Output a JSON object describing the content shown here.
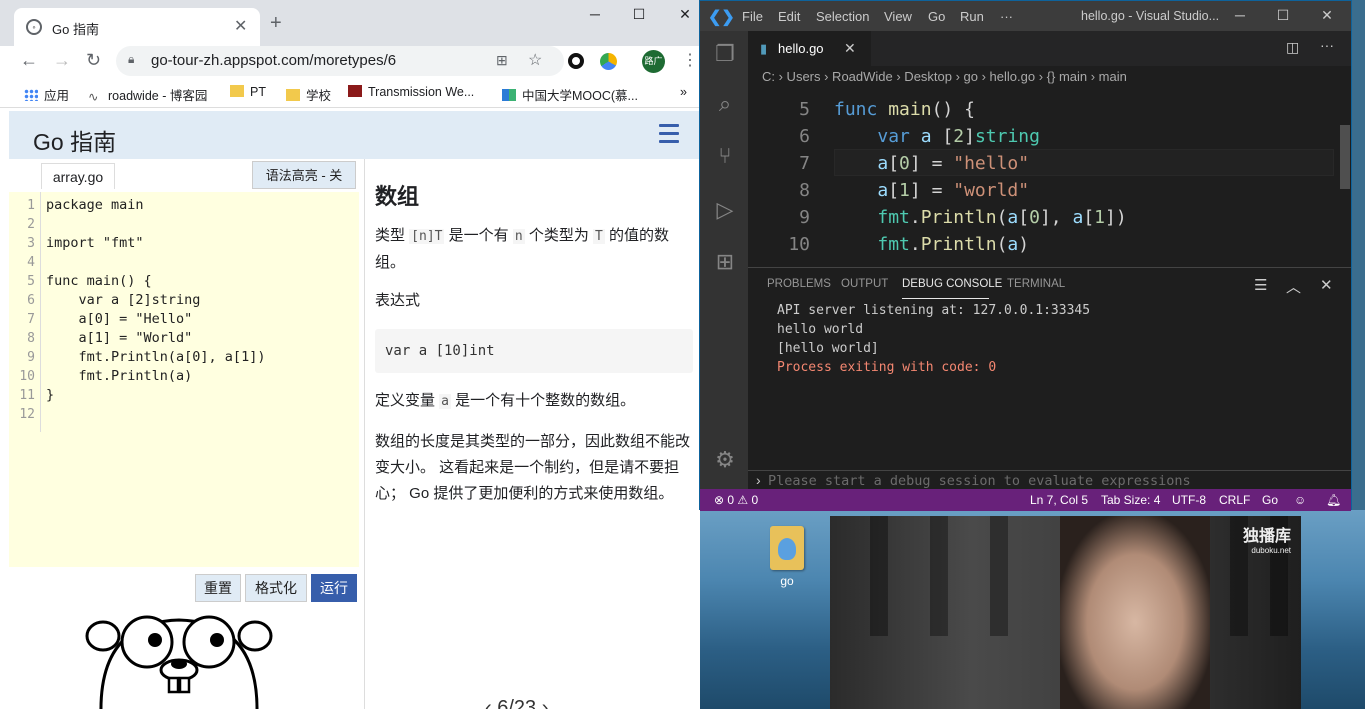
{
  "browser": {
    "tab_title": "Go 指南",
    "url": "go-tour-zh.appspot.com/moretypes/6",
    "profile_label": "路广",
    "bookmarks": [
      "应用",
      "roadwide - 博客园",
      "PT",
      "学校",
      "Transmission We...",
      "中国大学MOOC(慕..."
    ]
  },
  "tour": {
    "title": "Go 指南",
    "file_tab": "array.go",
    "syntax_toggle": "语法高亮 - 关",
    "line_numbers": [
      "1",
      "2",
      "3",
      "4",
      "5",
      "6",
      "7",
      "8",
      "9",
      "10",
      "11",
      "12"
    ],
    "code_lines": [
      "package main",
      "",
      "import \"fmt\"",
      "",
      "func main() {",
      "    var a [2]string",
      "    a[0] = \"Hello\"",
      "    a[1] = \"World\"",
      "    fmt.Println(a[0], a[1])",
      "    fmt.Println(a)",
      "}",
      ""
    ],
    "buttons": {
      "reset": "重置",
      "format": "格式化",
      "run": "运行"
    },
    "lesson_title": "数组",
    "p1_a": "类型 ",
    "p1_code1": "[n]T",
    "p1_b": " 是一个有 ",
    "p1_code2": "n",
    "p1_c": " 个类型为 ",
    "p1_code3": "T",
    "p1_d": " 的值的数组。",
    "p2": "表达式",
    "code_example": "var a [10]int",
    "p3_a": "定义变量 ",
    "p3_code": "a",
    "p3_b": " 是一个有十个整数的数组。",
    "p4": "数组的长度是其类型的一部分，因此数组不能改变大小。 这看起来是一个制约，但是请不要担心； Go 提供了更加便利的方式来使用数组。",
    "pager": "6/23"
  },
  "vscode": {
    "menu": [
      "File",
      "Edit",
      "Selection",
      "View",
      "Go",
      "Run",
      "···"
    ],
    "window_title": "hello.go - Visual Studio...",
    "tab": "hello.go",
    "breadcrumb": "C: › Users › RoadWide › Desktop › go › hello.go › {} main › main",
    "editor_line_numbers": [
      "5",
      "6",
      "7",
      "8",
      "9",
      "10"
    ],
    "panel_tabs": [
      "PROBLEMS",
      "OUTPUT",
      "DEBUG CONSOLE",
      "TERMINAL"
    ],
    "console_lines": [
      "API server listening at: 127.0.0.1:33345",
      "hello world",
      "[hello world]"
    ],
    "console_exit": "Process exiting with code: 0",
    "repl_placeholder": "Please start a debug session to evaluate expressions",
    "status": {
      "errors": "⊗ 0 ⚠ 0",
      "position": "Ln 7, Col 5",
      "tab_size": "Tab Size: 4",
      "encoding": "UTF-8",
      "eol": "CRLF",
      "language": "Go"
    },
    "accent_color": "#68217a"
  },
  "desktop": {
    "folder_label": "go",
    "video_logo": "独播库",
    "video_logo_sub": "duboku.net"
  }
}
